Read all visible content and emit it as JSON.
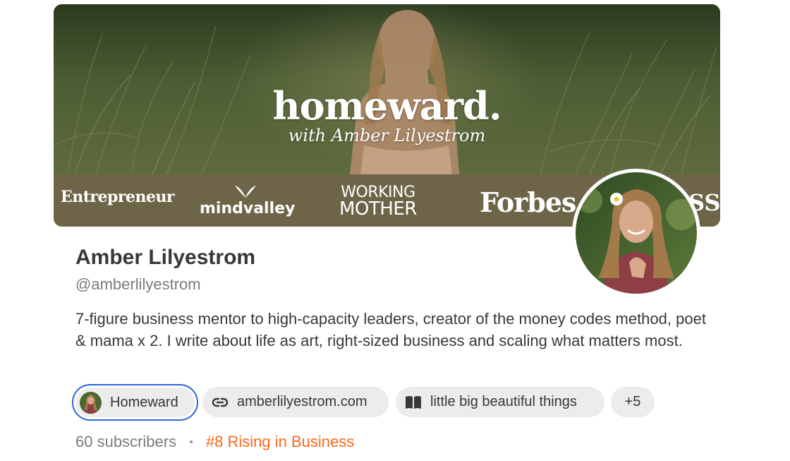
{
  "banner": {
    "title": "homeward.",
    "subtitle": "with Amber Lilyestrom",
    "logos": {
      "entrepreneur": "Entrepreneur",
      "mindvalley": "mindvalley",
      "working_line1": "WORKING",
      "working_line2": "MOTHER",
      "forbes": "Forbes",
      "partial": "SS"
    }
  },
  "profile": {
    "name": "Amber Lilyestrom",
    "handle": "@amberlilyestrom",
    "bio": "7-figure business mentor to high-capacity leaders, creator of the money codes method, poet & mama x 2. I write about life as art, right-sized business and scaling what matters most."
  },
  "chips": {
    "homeward": "Homeward",
    "website": "amberlilyestrom.com",
    "book": "little big beautiful things",
    "more": "+5"
  },
  "stats": {
    "subscribers": "60 subscribers",
    "separator": "•",
    "rank": "#8 Rising in Business"
  },
  "colors": {
    "accent_orange": "#ff6719",
    "focus_blue": "#2d63d6",
    "chip_bg": "#ececec",
    "text_primary": "#363737",
    "text_secondary": "#7b7b7b"
  },
  "icons": {
    "website_chip": "link-icon",
    "book_chip": "book-icon"
  }
}
